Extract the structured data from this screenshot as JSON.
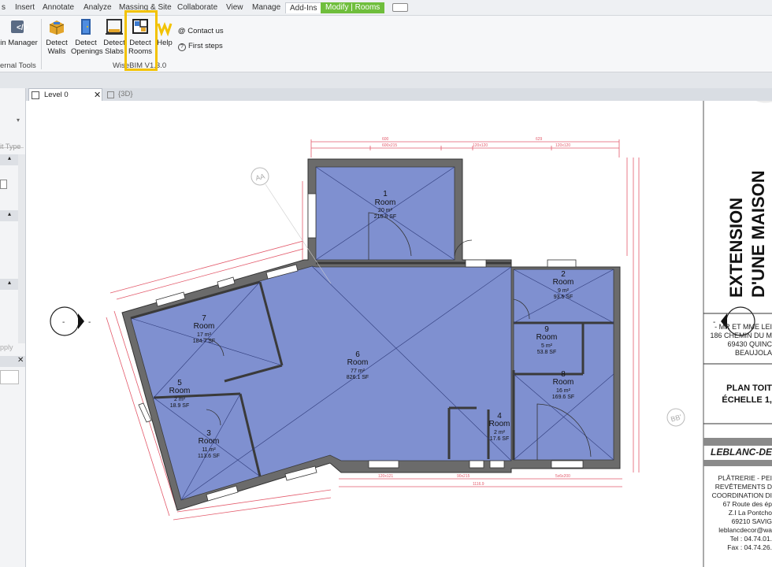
{
  "menu": {
    "items": [
      "s",
      "Insert",
      "Annotate",
      "Analyze",
      "Massing & Site",
      "Collaborate",
      "View",
      "Manage",
      "Add-Ins"
    ],
    "context_tab": "Modify | Rooms"
  },
  "ribbon": {
    "manager_label": "in Manager",
    "external_tools_label": "ernal Tools",
    "buttons": {
      "detect_walls": "Detect Walls",
      "detect_openings": "Detect Openings",
      "detect_slabs": "Detect Slabs",
      "detect_rooms": "Detect Rooms",
      "help": "Help"
    },
    "contact_us": "Contact us",
    "first_steps": "First steps",
    "panel_label": "WiseBIM V1.3.0",
    "highlight_color": "#f2c200"
  },
  "views": {
    "tabs": [
      {
        "label": "Level 0",
        "active": true
      },
      {
        "label": "{3D}",
        "active": false
      }
    ]
  },
  "left_panel": {
    "edit_type": "it Type",
    "apply": "pply"
  },
  "plan": {
    "room_color": "#8192d6",
    "rooms": [
      {
        "num": "1",
        "name": "Room",
        "area_m2": "20 m²",
        "area_sf": "215.8 SF"
      },
      {
        "num": "2",
        "name": "Room",
        "area_m2": "9 m²",
        "area_sf": "93.5 SF"
      },
      {
        "num": "9",
        "name": "Room",
        "area_m2": "5 m²",
        "area_sf": "53.8 SF"
      },
      {
        "num": "8",
        "name": "Room",
        "area_m2": "16 m²",
        "area_sf": "169.6 SF"
      },
      {
        "num": "7",
        "name": "Room",
        "area_m2": "17 m²",
        "area_sf": "184.7 SF"
      },
      {
        "num": "6",
        "name": "Room",
        "area_m2": "77 m²",
        "area_sf": "826.1 SF"
      },
      {
        "num": "5",
        "name": "Room",
        "area_m2": "2 m²",
        "area_sf": "18.9 SF"
      },
      {
        "num": "3",
        "name": "Room",
        "area_m2": "11 m²",
        "area_sf": "113.6 SF"
      },
      {
        "num": "4",
        "name": "Room",
        "area_m2": "2 m²",
        "area_sf": "17.6 SF"
      }
    ],
    "section_marks": [
      "AA",
      "BB'"
    ],
    "elevation_marker": "-",
    "dims": {
      "top_total": "629",
      "top_a": "600",
      "top_b": "600x215",
      "top_c": "120x120",
      "top_d": "120x120",
      "bottom_a": "1116.9",
      "bottom_b": "120x121",
      "bottom_c": "90x215",
      "bottom_d": "5x6x200"
    }
  },
  "title_block": {
    "title_line1": "EXTENSION",
    "title_line2": "D'UNE MAISON",
    "client_lines": [
      "- MR ET MME LEI",
      "186 CHEMIN DU M",
      "69430 QUINC",
      "BEAUJOLA"
    ],
    "sheet_lines": [
      "PLAN TOIT",
      "ÉCHELLE 1,"
    ],
    "company": "LEBLANC-DEC",
    "company_lines": [
      "PLÂTRERIE - PEI",
      "REVÊTEMENTS D",
      "COORDINATION DI",
      "67 Route des ép",
      "Z.I La Pontcho",
      "69210 SAVIG",
      "leblancdecor@wa",
      "Tel : 04.74.01.",
      "Fax : 04.74.26."
    ]
  }
}
